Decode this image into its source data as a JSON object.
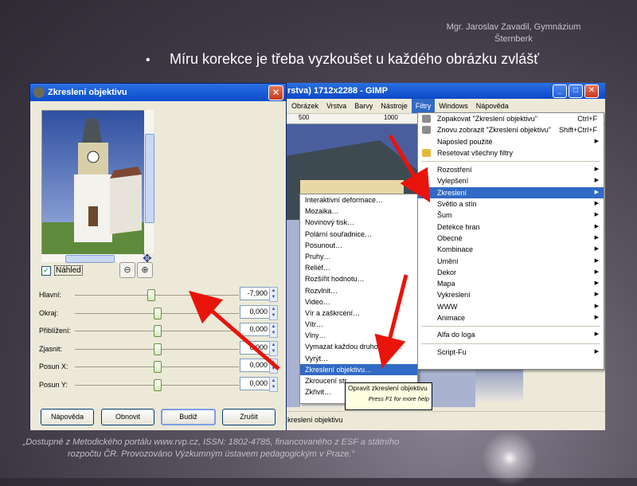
{
  "slide": {
    "author": "Mgr. Jaroslav Zavadil, Gymnázium Šternberk",
    "bullet": "Míru korekce je třeba vyzkoušet u každého obrázku zvlášť",
    "footer": "„Dostupné z Metodického portálu www.rvp.cz, ISSN: 1802-4785, financovaného z ESF a státního rozpočtu ČR. Provozováno Výzkumným ústavem pedagogickým v Praze.“"
  },
  "gimp": {
    "title": "rstva) 1712x2288 - GIMP",
    "menubar": [
      "Obrázek",
      "Vrstva",
      "Barvy",
      "Nástroje",
      "Filtry",
      "Windows",
      "Nápověda"
    ],
    "active_menu": "Filtry",
    "ruler": [
      "500",
      "1000"
    ],
    "status": "kreslení objektivu"
  },
  "filtry_menu": {
    "top": [
      {
        "label": "Zopakovat \"Zkreslení objektivu\"",
        "shortcut": "Ctrl+F",
        "icon": "repeat-icon"
      },
      {
        "label": "Znovu zobrazit \"Zkreslení objektivu\"",
        "shortcut": "Shift+Ctrl+F",
        "icon": "reshow-icon"
      },
      {
        "label": "Naposled použité",
        "arrow": true
      },
      {
        "label": "Resetovat všechny filtry",
        "icon": "reset-icon"
      }
    ],
    "groups": [
      {
        "label": "Rozostření",
        "arrow": true
      },
      {
        "label": "Vylepšení",
        "arrow": true
      },
      {
        "label": "Zkreslení",
        "arrow": true,
        "highlighted": true
      },
      {
        "label": "Světlo a stín",
        "arrow": true
      },
      {
        "label": "Šum",
        "arrow": true
      },
      {
        "label": "Detekce hran",
        "arrow": true
      },
      {
        "label": "Obecné",
        "arrow": true
      },
      {
        "label": "Kombinace",
        "arrow": true
      },
      {
        "label": "Umění",
        "arrow": true
      },
      {
        "label": "Dekor",
        "arrow": true
      },
      {
        "label": "Mapa",
        "arrow": true
      },
      {
        "label": "Vykreslení",
        "arrow": true
      },
      {
        "label": "WWW",
        "arrow": true
      },
      {
        "label": "Animace",
        "arrow": true
      }
    ],
    "bottom1": [
      {
        "label": "Alfa do loga",
        "arrow": true
      }
    ],
    "bottom2": [
      {
        "label": "Script-Fu",
        "arrow": true
      }
    ]
  },
  "zkresleni_menu": [
    {
      "label": "Interaktivní deformace…"
    },
    {
      "label": "Mozaika…"
    },
    {
      "label": "Novinový tisk…"
    },
    {
      "label": "Polární souřadnice…"
    },
    {
      "label": "Posunout…"
    },
    {
      "label": "Pruhy…"
    },
    {
      "label": "Reliéf…"
    },
    {
      "label": "Rozšířit hodnotu…"
    },
    {
      "label": "Rozvlnit…"
    },
    {
      "label": "Video…"
    },
    {
      "label": "Vír a zaškrcení…"
    },
    {
      "label": "Vítr…"
    },
    {
      "label": "Vlny…"
    },
    {
      "label": "Vymazat každou druhou …u…"
    },
    {
      "label": "Vyrýt…"
    },
    {
      "label": "Zkreslení objektivu…",
      "highlighted": true
    },
    {
      "label": "Zkroucení str…"
    },
    {
      "label": "Zkřivit…"
    }
  ],
  "tooltip": {
    "text": "Opravit zkreslení objektivu",
    "hint": "Press F1 for more help"
  },
  "dialog": {
    "title": "Zkreslení objektivu",
    "preview_label": "Náhled",
    "preview_checked": true,
    "sliders": [
      {
        "label": "Hlavní:",
        "value": "-7,900",
        "fraction": 0.46
      },
      {
        "label": "Okraj:",
        "value": "0,000",
        "fraction": 0.5
      },
      {
        "label": "Přiblížení:",
        "value": "0,000",
        "fraction": 0.5
      },
      {
        "label": "Zjasnit:",
        "value": "0,000",
        "fraction": 0.5
      },
      {
        "label": "Posun X:",
        "value": "0,000",
        "fraction": 0.5
      },
      {
        "label": "Posun Y:",
        "value": "0,000",
        "fraction": 0.5
      }
    ],
    "buttons": {
      "help": "Nápověda",
      "reset": "Obnovit",
      "ok": "Budiž",
      "cancel": "Zrušit"
    }
  },
  "colors": {
    "xp_title": "#0b4bcc",
    "menu_highlight": "#316ac5",
    "arrow": "#e8140c"
  }
}
